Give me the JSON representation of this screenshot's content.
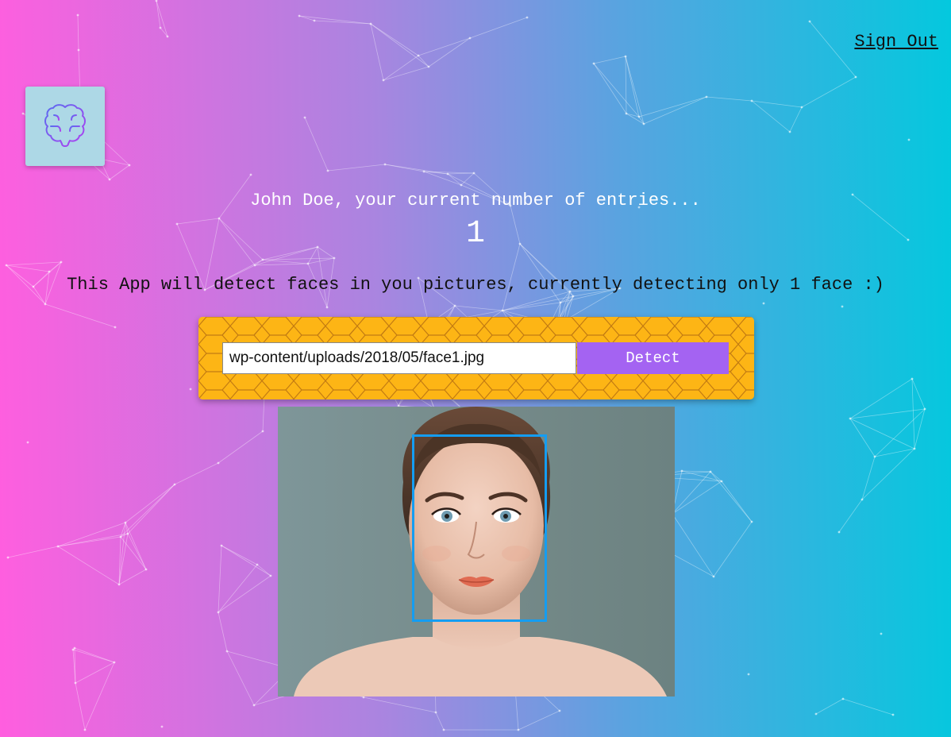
{
  "header": {
    "sign_out_label": "Sign Out"
  },
  "logo": {
    "icon": "brain-icon",
    "background_color": "#add8e6",
    "stroke_color": "#8a3ff0"
  },
  "rank": {
    "greeting": "John Doe, your current number of entries...",
    "entries": "1"
  },
  "intro": {
    "description": "This App will detect faces in you pictures, currently detecting only 1 face :)"
  },
  "image_form": {
    "url_value": "wp-content/uploads/2018/05/face1.jpg",
    "detect_label": "Detect",
    "panel_color": "#fdb515",
    "button_color": "#a463f2"
  },
  "result": {
    "image_subject": "portrait-photo",
    "face_box_color": "#149df2",
    "faces_detected": 1
  }
}
